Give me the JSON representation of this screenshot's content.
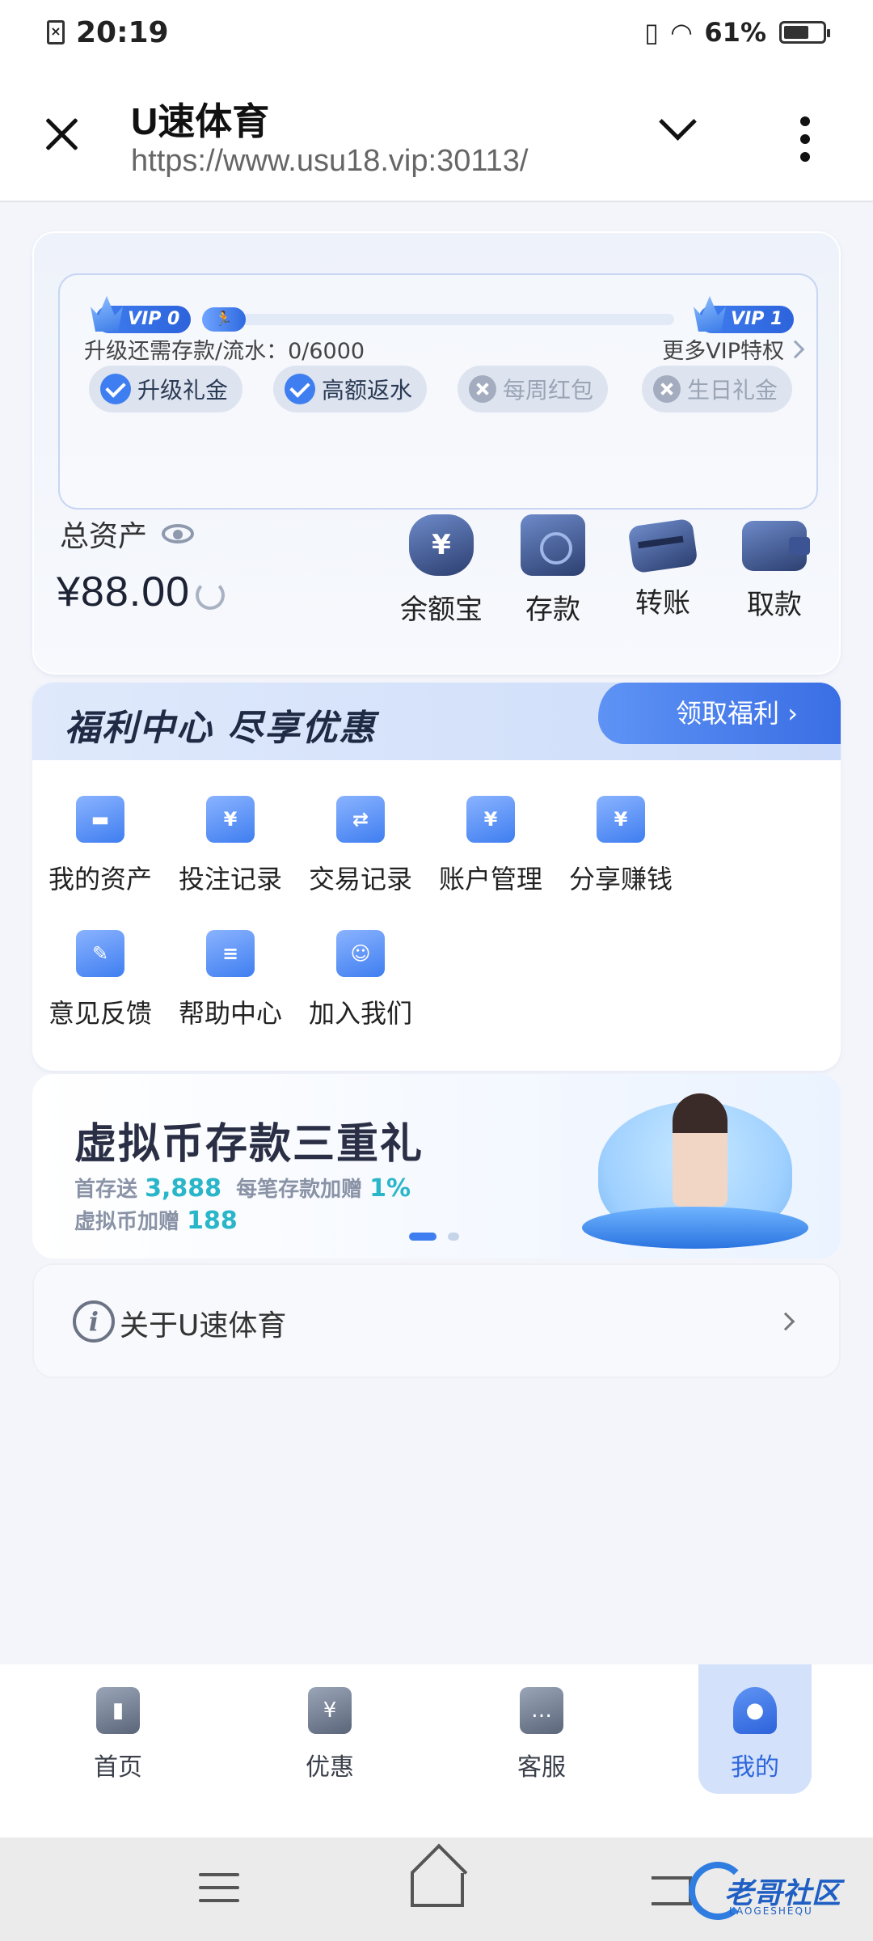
{
  "status_bar": {
    "time": "20:19",
    "battery": "61%"
  },
  "browser": {
    "title": "U速体育",
    "url": "https://www.usu18.vip:30113/"
  },
  "vip": {
    "current_level": "VIP 0",
    "next_level": "VIP 1",
    "need_text": "升级还需存款/流水：0/6000",
    "progress": {
      "current": 0,
      "target": 6000
    },
    "more_link": "更多VIP特权",
    "perks": [
      {
        "label": "升级礼金",
        "enabled": true
      },
      {
        "label": "高额返水",
        "enabled": true
      },
      {
        "label": "每周红包",
        "enabled": false
      },
      {
        "label": "生日礼金",
        "enabled": false
      }
    ]
  },
  "assets": {
    "label": "总资产",
    "amount": "¥88.00"
  },
  "quick_actions": [
    {
      "label": "余额宝",
      "icon": "money-bag-icon"
    },
    {
      "label": "存款",
      "icon": "safe-icon"
    },
    {
      "label": "转账",
      "icon": "cards-icon"
    },
    {
      "label": "取款",
      "icon": "wallet-icon"
    }
  ],
  "welfare": {
    "title": "福利中心  尽享优惠",
    "button": "领取福利"
  },
  "menu": [
    {
      "label": "我的资产",
      "icon": "wallet-icon",
      "glyph": "▬"
    },
    {
      "label": "投注记录",
      "icon": "bet-record-icon",
      "glyph": "¥"
    },
    {
      "label": "交易记录",
      "icon": "transaction-icon",
      "glyph": "⇄"
    },
    {
      "label": "账户管理",
      "icon": "account-folder-icon",
      "glyph": "¥"
    },
    {
      "label": "分享赚钱",
      "icon": "share-earn-icon",
      "glyph": "¥"
    },
    {
      "label": "意见反馈",
      "icon": "feedback-icon",
      "glyph": "✎"
    },
    {
      "label": "帮助中心",
      "icon": "help-book-icon",
      "glyph": "≡"
    },
    {
      "label": "加入我们",
      "icon": "join-users-icon",
      "glyph": "☺"
    }
  ],
  "banner": {
    "title": "虚拟币存款三重礼",
    "line1_prefix": "首存送",
    "line1_value": "3,888",
    "line1_mid": "每笔存款加赠",
    "line1_pct": "1%",
    "line2_prefix": "虚拟币加赠",
    "line2_value": "188"
  },
  "about": {
    "label": "关于U速体育"
  },
  "tabs": [
    {
      "label": "首页",
      "icon": "home-icon",
      "glyph": "▮",
      "active": false
    },
    {
      "label": "优惠",
      "icon": "coupon-icon",
      "glyph": "¥",
      "active": false
    },
    {
      "label": "客服",
      "icon": "customer-service-icon",
      "glyph": "…",
      "active": false
    },
    {
      "label": "我的",
      "icon": "profile-icon",
      "glyph": "●",
      "active": true
    }
  ],
  "watermark": {
    "text": "老哥社区",
    "sub": "LAOGESHEQU"
  }
}
